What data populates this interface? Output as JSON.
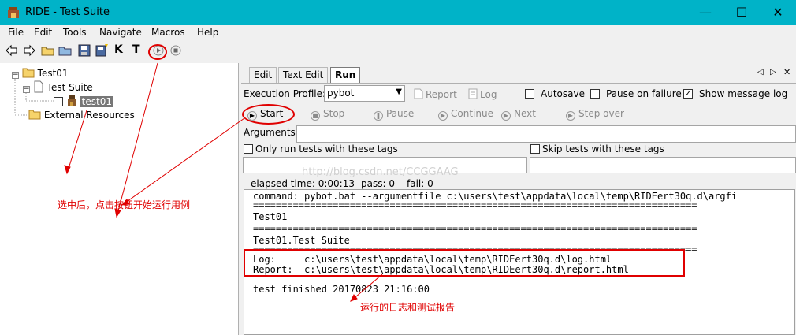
{
  "window": {
    "title": "RIDE - Test Suite"
  },
  "menu": [
    "File",
    "Edit",
    "Tools",
    "Navigate",
    "Macros",
    "Help"
  ],
  "tree": {
    "root": "Test01",
    "suite": "Test Suite",
    "testcase": "test01",
    "resources": "External Resources"
  },
  "tabs": [
    "Edit",
    "Text Edit",
    "Run"
  ],
  "run": {
    "profile_label": "Execution Profile:",
    "profile_value": "pybot",
    "report": "Report",
    "log": "Log",
    "autosave": "Autosave",
    "pause_on_failure": "Pause on failure",
    "show_message_log": "Show message log",
    "start": "Start",
    "stop": "Stop",
    "pause": "Pause",
    "continue": "Continue",
    "next": "Next",
    "step_over": "Step over",
    "arguments_label": "Arguments:",
    "only_run_tags": "Only run tests with these tags",
    "skip_tags": "Skip tests with these tags",
    "elapsed": "elapsed time: 0:00:13",
    "pass": "pass: 0",
    "fail": "fail: 0"
  },
  "console": [
    "command: pybot.bat --argumentfile c:\\users\\test\\appdata\\local\\temp\\RIDEert30q.d\\argfi",
    "==============================================================================",
    "Test01",
    "==============================================================================",
    "Test01.Test Suite",
    "==============================================================================",
    "Log:     c:\\users\\test\\appdata\\local\\temp\\RIDEert30q.d\\log.html",
    "Report:  c:\\users\\test\\appdata\\local\\temp\\RIDEert30q.d\\report.html",
    "test finished 20170823 21:16:00"
  ],
  "annotations": {
    "select_then_start": "选中后，点击按钮开始运行用例",
    "log_and_report": "运行的日志和测试报告"
  },
  "watermark": "http://blog.csdn.net/CCGGAAG"
}
